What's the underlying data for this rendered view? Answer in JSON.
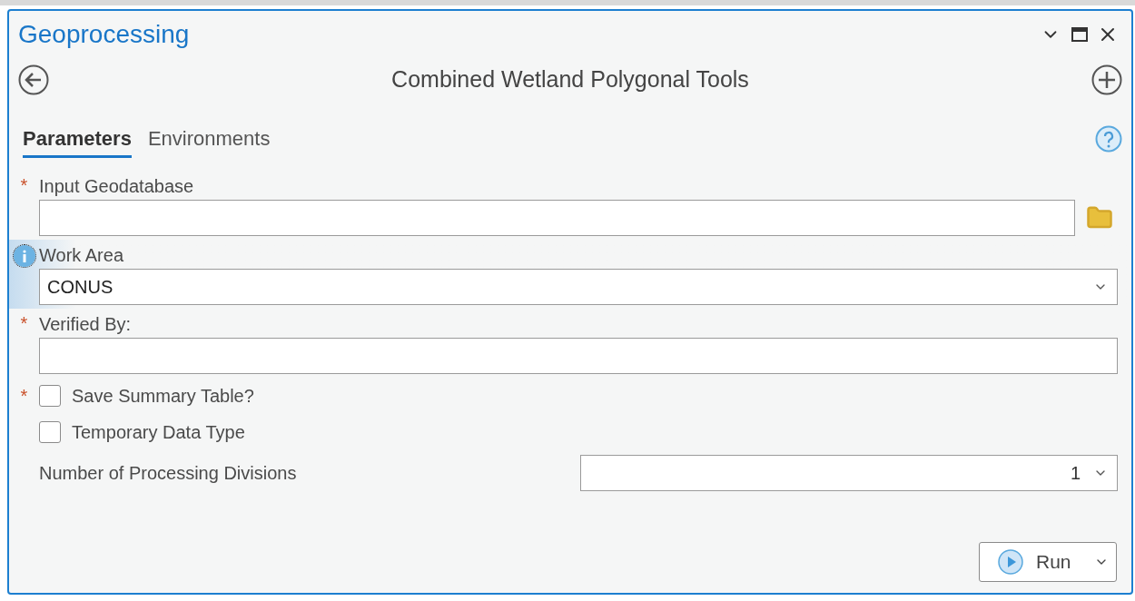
{
  "pane": {
    "title": "Geoprocessing"
  },
  "tool": {
    "title": "Combined Wetland Polygonal Tools"
  },
  "tabs": [
    {
      "label": "Parameters",
      "selected": true
    },
    {
      "label": "Environments",
      "selected": false
    }
  ],
  "parameters": [
    {
      "kind": "file",
      "label": "Input Geodatabase",
      "required_mark": "*",
      "info": false
    },
    {
      "kind": "dropdown",
      "label": "Work Area",
      "info": true,
      "value": "CONUS"
    },
    {
      "kind": "text",
      "label": "Verified By:",
      "required_mark": "*",
      "info": false
    },
    {
      "kind": "checkbox",
      "label": "Save Summary Table?",
      "required_mark": "*",
      "checked": false
    },
    {
      "kind": "checkbox",
      "label": "Temporary Data Type",
      "checked": false
    },
    {
      "kind": "inline-dropdown",
      "label": "Number of Processing Divisions",
      "value": "1"
    }
  ],
  "run_button": {
    "label": "Run"
  }
}
